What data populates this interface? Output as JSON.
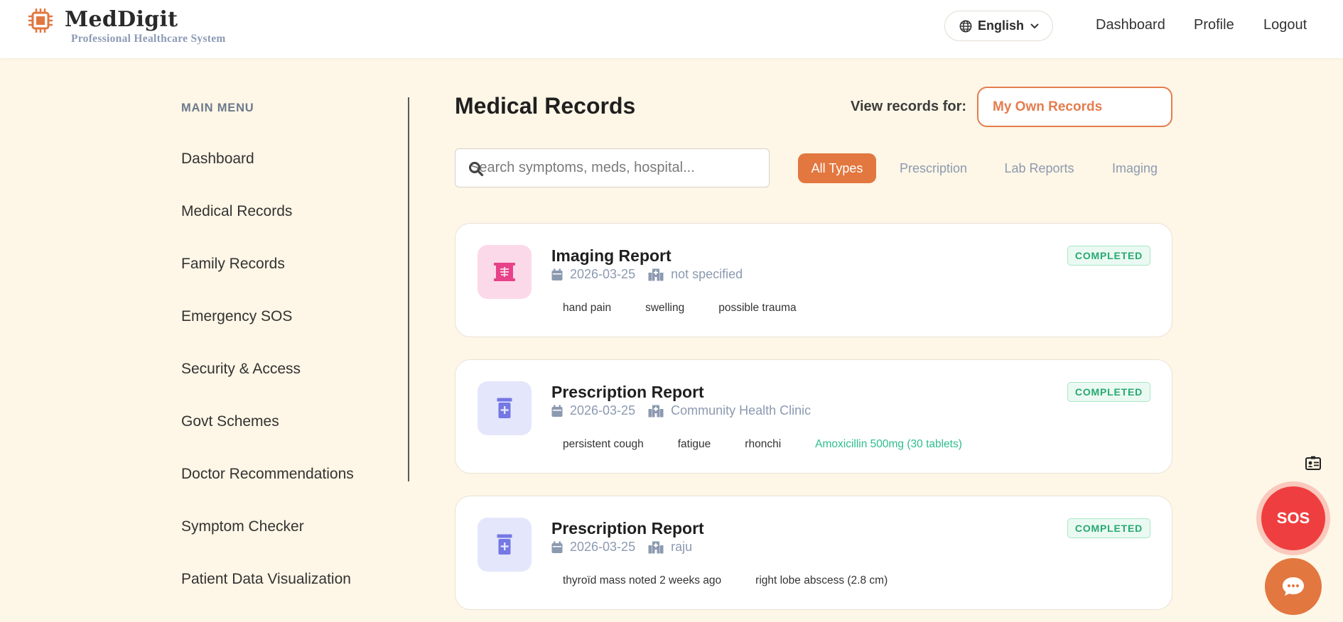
{
  "brand": {
    "title": "MedDigit",
    "subtitle": "Professional Healthcare System",
    "logo_icon": "chip-icon",
    "accent": "#e2773f"
  },
  "header": {
    "language": "English",
    "nav": [
      "Dashboard",
      "Profile",
      "Logout"
    ]
  },
  "sidebar": {
    "title": "MAIN MENU",
    "items": [
      {
        "label": "Dashboard"
      },
      {
        "label": "Medical Records"
      },
      {
        "label": "Family Records"
      },
      {
        "label": "Emergency SOS"
      },
      {
        "label": "Security & Access"
      },
      {
        "label": "Govt Schemes"
      },
      {
        "label": "Doctor Recommendations"
      },
      {
        "label": "Symptom Checker"
      },
      {
        "label": "Patient Data Visualization"
      }
    ]
  },
  "main": {
    "title": "Medical Records",
    "view_label": "View records for:",
    "view_value": "My Own Records",
    "search_placeholder": "Search symptoms, meds, hospital...",
    "filters": [
      "All Types",
      "Prescription",
      "Lab Reports",
      "Imaging"
    ],
    "active_filter": "All Types",
    "records": [
      {
        "title": "Imaging Report",
        "date": "2026-03-25",
        "hospital": "not specified",
        "status": "COMPLETED",
        "icon": "x-ray-icon",
        "tags": [
          "hand pain",
          "swelling",
          "possible trauma"
        ],
        "meds": []
      },
      {
        "title": "Prescription Report",
        "date": "2026-03-25",
        "hospital": "Community Health Clinic",
        "status": "COMPLETED",
        "icon": "prescription-bottle-icon",
        "tags": [
          "persistent cough",
          "fatigue",
          "rhonchi"
        ],
        "meds": [
          "Amoxicillin 500mg (30 tablets)"
        ]
      },
      {
        "title": "Prescription Report",
        "date": "2026-03-25",
        "hospital": "raju",
        "status": "COMPLETED",
        "icon": "prescription-bottle-icon",
        "tags": [
          "thyroïd mass noted 2 weeks ago",
          "right lobe abscess (2.8 cm)"
        ],
        "meds": []
      }
    ]
  },
  "floating": {
    "sos_label": "SOS",
    "chat_icon": "chat-bubble-icon",
    "id_icon": "id-card-icon"
  }
}
